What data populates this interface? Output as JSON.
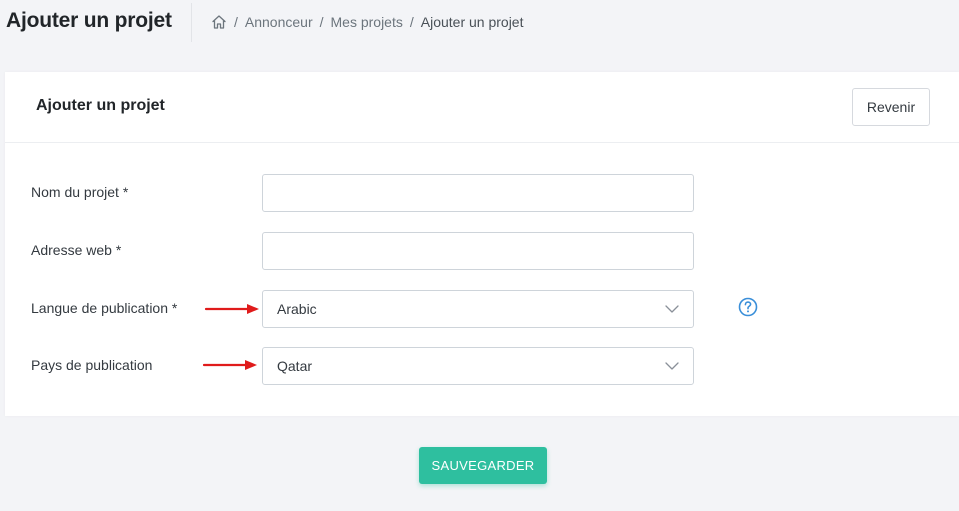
{
  "header": {
    "title": "Ajouter un projet",
    "breadcrumb": {
      "home_icon": "home-icon",
      "separator": "/",
      "items": [
        "Annonceur",
        "Mes projets",
        "Ajouter un projet"
      ]
    }
  },
  "card": {
    "title": "Ajouter un projet",
    "back_label": "Revenir"
  },
  "form": {
    "project_name": {
      "label": "Nom du projet *",
      "value": ""
    },
    "website": {
      "label": "Adresse web *",
      "value": ""
    },
    "language": {
      "label": "Langue de publication *",
      "value": "Arabic",
      "help_icon": "question-circle-icon"
    },
    "country": {
      "label": "Pays de publication",
      "value": "Qatar"
    }
  },
  "actions": {
    "save_label": "SAUVEGARDER"
  },
  "colors": {
    "accent": "#2ebf9f",
    "help_icon": "#3a8fd9",
    "annotation_arrow": "#e01b1b"
  }
}
